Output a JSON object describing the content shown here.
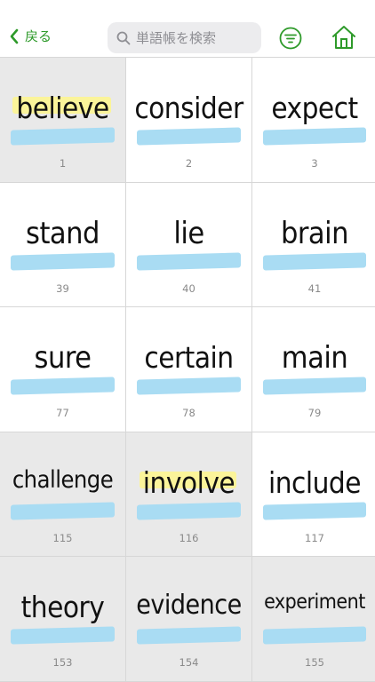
{
  "nav": {
    "back_label": "戻る",
    "search_placeholder": "単語帳を検索",
    "accent_color": "#2e9a2a"
  },
  "cards": [
    {
      "word": "believe",
      "number": "1",
      "shaded": true,
      "yellow": true,
      "size": 33
    },
    {
      "word": "consider",
      "number": "2",
      "shaded": false,
      "yellow": false,
      "size": 33
    },
    {
      "word": "expect",
      "number": "3",
      "shaded": false,
      "yellow": false,
      "size": 33
    },
    {
      "word": "stand",
      "number": "39",
      "shaded": false,
      "yellow": false,
      "size": 34
    },
    {
      "word": "lie",
      "number": "40",
      "shaded": false,
      "yellow": false,
      "size": 34
    },
    {
      "word": "brain",
      "number": "41",
      "shaded": false,
      "yellow": false,
      "size": 34
    },
    {
      "word": "sure",
      "number": "77",
      "shaded": false,
      "yellow": false,
      "size": 34
    },
    {
      "word": "certain",
      "number": "78",
      "shaded": false,
      "yellow": false,
      "size": 33
    },
    {
      "word": "main",
      "number": "79",
      "shaded": false,
      "yellow": false,
      "size": 34
    },
    {
      "word": "challenge",
      "number": "115",
      "shaded": true,
      "yellow": false,
      "size": 27
    },
    {
      "word": "involve",
      "number": "116",
      "shaded": true,
      "yellow": true,
      "size": 33
    },
    {
      "word": "include",
      "number": "117",
      "shaded": false,
      "yellow": false,
      "size": 33
    },
    {
      "word": "theory",
      "number": "153",
      "shaded": true,
      "yellow": false,
      "size": 33
    },
    {
      "word": "evidence",
      "number": "154",
      "shaded": true,
      "yellow": false,
      "size": 30
    },
    {
      "word": "experiment",
      "number": "155",
      "shaded": true,
      "yellow": false,
      "size": 23
    }
  ]
}
